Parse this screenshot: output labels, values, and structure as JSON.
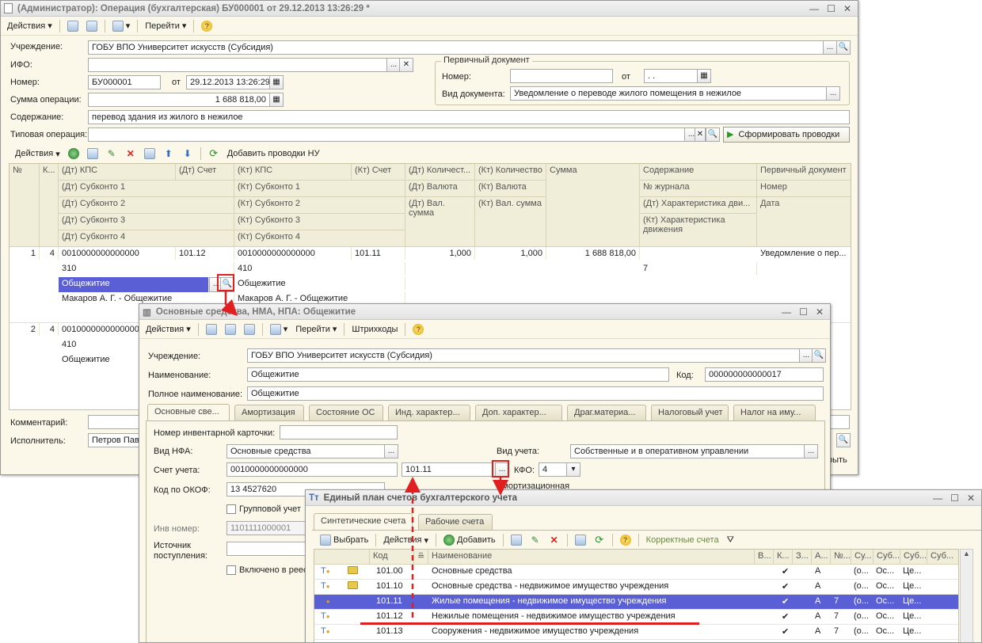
{
  "main": {
    "title": "(Администратор): Операция (бухгалтерская) БУ000001 от 29.12.2013 13:26:29 *",
    "toolbar": {
      "actions": "Действия",
      "goto": "Перейти"
    },
    "labels": {
      "institution": "Учреждение:",
      "ifo": "ИФО:",
      "number": "Номер:",
      "from": "от",
      "sum": "Сумма операции:",
      "content": "Содержание:",
      "typical": "Типовая операция:",
      "comment": "Комментарий:",
      "executor": "Исполнитель:"
    },
    "values": {
      "institution": "ГОБУ ВПО Университет искусств (Субсидия)",
      "ifo": "",
      "number": "БУ000001",
      "date": "29.12.2013 13:26:29",
      "sum": "1 688 818,00",
      "content": "перевод здания из жилого в нежилое",
      "typical": "",
      "executor": "Петров Пав"
    },
    "primary_doc": {
      "title": "Первичный документ",
      "number_label": "Номер:",
      "from_label": "от",
      "date_value": ". .",
      "doctype_label": "Вид документа:",
      "doctype_value": "Уведомление о переводе жилого помещения в нежилое"
    },
    "form_btn": "Сформировать проводки",
    "grid_toolbar": {
      "actions": "Действия",
      "add_nu": "Добавить проводки НУ"
    },
    "grid_headers": {
      "n": "№",
      "k": "К...",
      "dt_kps": "(Дт) КПС",
      "dt_acc": "(Дт) Счет",
      "kt_kps": "(Кт) КПС",
      "kt_acc": "(Кт) Счет",
      "dt_qty": "(Дт) Количест...",
      "kt_qty": "(Кт) Количество",
      "sum": "Сумма",
      "content": "Содержание",
      "primary": "Первичный документ",
      "dt_sub1": "(Дт) Субконто 1",
      "kt_sub1": "(Кт) Субконто 1",
      "dt_cur": "(Дт) Валюта",
      "kt_cur": "(Кт) Валюта",
      "journal": "№ журнала",
      "num": "Номер",
      "dt_sub2": "(Дт) Субконто 2",
      "kt_sub2": "(Кт) Субконто 2",
      "dt_cursum": "(Дт) Вал. сумма",
      "kt_cursum": "(Кт) Вал. сумма",
      "dt_char": "(Дт) Характеристика дви...",
      "date": "Дата",
      "dt_sub3": "(Дт) Субконто 3",
      "kt_sub3": "(Кт) Субконто 3",
      "kt_char": "(Кт) Характеристика движения",
      "dt_sub4": "(Дт) Субконто 4",
      "kt_sub4": "(Кт) Субконто 4"
    },
    "rows": [
      {
        "n": "1",
        "k": "4",
        "dt_kps": "0010000000000000",
        "dt_acc": "101.12",
        "kt_kps": "0010000000000000",
        "kt_acc": "101.11",
        "dt_qty": "1,000",
        "kt_qty": "1,000",
        "sum": "1 688 818,00",
        "primary": "Уведомление о пер...",
        "dt_s1": "310",
        "kt_s1": "410",
        "journal": "7",
        "dt_s2": "Общежитие",
        "kt_s2": "Общежитие",
        "dt_s3": "Макаров А. Г. - Общежитие",
        "kt_s3": "Макаров А. Г. - Общежитие"
      },
      {
        "n": "2",
        "k": "4",
        "dt_kps": "0010000000000000",
        "dt_s1": "410",
        "dt_s2": "Общежитие"
      }
    ],
    "bottom_right_btn": "рыть"
  },
  "os": {
    "title": "Основные средства, НМА, НПА: Общежитие",
    "toolbar": {
      "actions": "Действия",
      "goto": "Перейти",
      "barcodes": "Штрихкоды"
    },
    "labels": {
      "institution": "Учреждение:",
      "name": "Наименование:",
      "code": "Код:",
      "fullname": "Полное наименование:"
    },
    "values": {
      "institution": "ГОБУ ВПО Университет искусств (Субсидия)",
      "name": "Общежитие",
      "code": "000000000000017",
      "fullname": "Общежитие"
    },
    "tabs": [
      "Основные све...",
      "Амортизация",
      "Состояние ОС",
      "Инд. характер...",
      "Доп. характер...",
      "Драг.материа...",
      "Налоговый учет",
      "Налог на иму..."
    ],
    "fields": {
      "inv_card_label": "Номер инвентарной карточки:",
      "inv_card_value": "",
      "nfa_label": "Вид НФА:",
      "nfa_value": "Основные средства",
      "accounting_label": "Вид учета:",
      "accounting_value": "Собственные и в оперативном управлении",
      "account_label": "Счет учета:",
      "account_kps": "0010000000000000",
      "account_value": "101.11",
      "kfo_label": "КФО:",
      "kfo_value": "4",
      "okof_label": "Код по ОКОФ:",
      "okof_value": "13 4527620",
      "amort_label": "Амортизационная",
      "group_label": "Групповой учет",
      "inv_num_label": "Инв номер:",
      "inv_num_value": "1101111000001",
      "source_label": "Источник поступления:",
      "included_label": "Включено в реес"
    }
  },
  "plan": {
    "title": "Единый план счетов бухгалтерского учета",
    "tabs": [
      "Синтетические счета",
      "Рабочие счета"
    ],
    "toolbar": {
      "choose": "Выбрать",
      "actions": "Действия",
      "add": "Добавить",
      "correct": "Корректные счета"
    },
    "headers": {
      "code": "Код",
      "name": "Наименование",
      "v": "В...",
      "k": "К...",
      "z": "З...",
      "a": "А...",
      "n": "№...",
      "su": "Су...",
      "sub1": "Суб...",
      "sub2": "Суб...",
      "sub3": "Суб..."
    },
    "rows": [
      {
        "code": "101.00",
        "name": "Основные средства",
        "a": "А",
        "n": "",
        "su": "(о...",
        "s1": "Ос...",
        "s2": "Це...",
        "folder": true
      },
      {
        "code": "101.10",
        "name": "Основные средства - недвижимое имущество учреждения",
        "a": "А",
        "n": "",
        "su": "(о...",
        "s1": "Ос...",
        "s2": "Це...",
        "folder": true
      },
      {
        "code": "101.11",
        "name": "Жилые помещения - недвижимое имущество учреждения",
        "a": "А",
        "n": "7",
        "su": "(о...",
        "s1": "Ос...",
        "s2": "Це...",
        "folder": false
      },
      {
        "code": "101.12",
        "name": "Нежилые помещения - недвижимое имущество учреждения",
        "a": "А",
        "n": "7",
        "su": "(о...",
        "s1": "Ос...",
        "s2": "Це...",
        "folder": false
      },
      {
        "code": "101.13",
        "name": "Сооружения - недвижимое имущество учреждения",
        "a": "А",
        "n": "7",
        "su": "(о...",
        "s1": "Ос...",
        "s2": "Це...",
        "folder": false
      }
    ]
  }
}
